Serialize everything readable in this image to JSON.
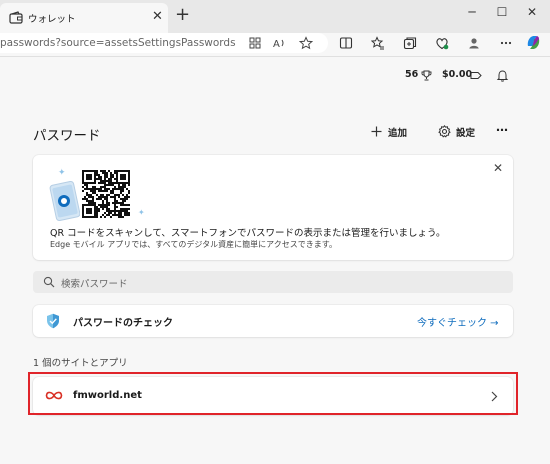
{
  "tab": {
    "title": "ウォレット"
  },
  "address": {
    "url": "passwords?source=assetsSettingsPasswords"
  },
  "rewards": {
    "points": "56",
    "balance": "$0.00"
  },
  "header": {
    "title": "パスワード",
    "add_label": "追加",
    "settings_label": "設定"
  },
  "qr_card": {
    "line1": "QR コードをスキャンして、スマートフォンでパスワードの表示または管理を行いましょう。",
    "line2": "Edge モバイル アプリでは、すべてのデジタル資産に簡単にアクセスできます。"
  },
  "search": {
    "placeholder": "検索パスワード"
  },
  "password_check": {
    "label": "パスワードのチェック",
    "link": "今すぐチェック →"
  },
  "sites": {
    "heading": "1 個のサイトとアプリ",
    "items": [
      {
        "name": "fmworld.net"
      }
    ]
  },
  "colors": {
    "accent": "#0f6cbd",
    "highlight": "#e0242a",
    "site_icon": "#d93025"
  }
}
